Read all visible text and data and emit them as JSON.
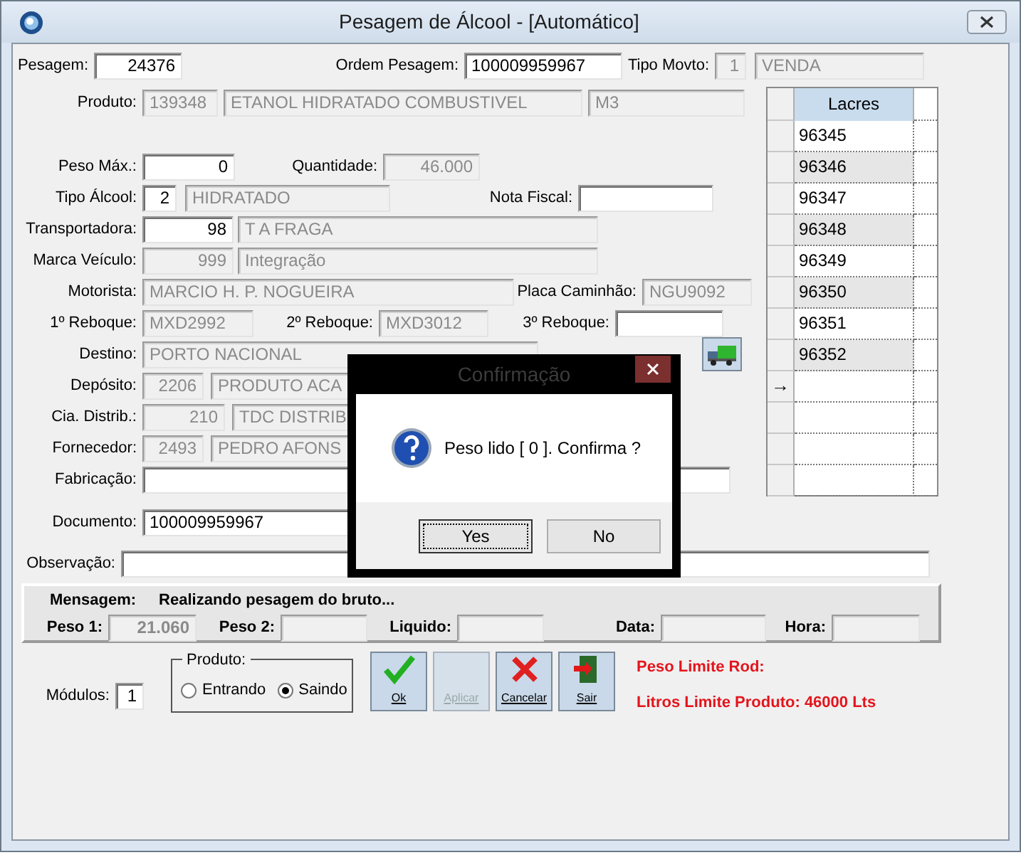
{
  "window": {
    "title": "Pesagem de Álcool - [Automático]"
  },
  "fields": {
    "pesagem": {
      "label": "Pesagem:",
      "parts": [
        {
          "text": "24376",
          "disabled": false
        }
      ]
    },
    "ordem_pesagem": {
      "label": "Ordem Pesagem:",
      "parts": [
        {
          "text": "100009959967",
          "disabled": false
        }
      ]
    },
    "tipo_movto": {
      "label": "Tipo Movto:",
      "parts": [
        {
          "text": "1",
          "disabled": true
        },
        {
          "text": "VENDA",
          "disabled": true
        }
      ]
    },
    "produto": {
      "label": "Produto:",
      "parts": [
        {
          "text": "139348",
          "disabled": true
        },
        {
          "text": "ETANOL HIDRATADO COMBUSTIVEL",
          "disabled": true
        },
        {
          "text": "M3",
          "disabled": true
        }
      ]
    },
    "peso_max": {
      "label": "Peso Máx.:",
      "parts": [
        {
          "text": "0",
          "disabled": false
        }
      ]
    },
    "quantidade": {
      "label": "Quantidade:",
      "parts": [
        {
          "text": "46.000",
          "disabled": true
        }
      ]
    },
    "tipo_alcool": {
      "label": "Tipo Álcool:",
      "parts": [
        {
          "text": "2",
          "disabled": false
        },
        {
          "text": "HIDRATADO",
          "disabled": true
        }
      ]
    },
    "nota_fiscal": {
      "label": "Nota Fiscal:",
      "parts": [
        {
          "disabled": false
        }
      ]
    },
    "transportadora": {
      "label": "Transportadora:",
      "parts": [
        {
          "text": "98",
          "disabled": false
        },
        {
          "text": "T A FRAGA",
          "disabled": true
        }
      ]
    },
    "marca_veiculo": {
      "label": "Marca Veículo:",
      "parts": [
        {
          "text": "999",
          "disabled": true
        },
        {
          "text": "Integração",
          "disabled": true
        }
      ]
    },
    "motorista": {
      "label": "Motorista:",
      "parts": [
        {
          "text": "MARCIO H. P. NOGUEIRA",
          "disabled": true
        }
      ]
    },
    "placa_caminhao": {
      "label": "Placa Caminhão:",
      "parts": [
        {
          "text": "NGU9092",
          "disabled": true
        }
      ]
    },
    "reboque_1": {
      "label": "1º Reboque:",
      "parts": [
        {
          "text": "MXD2992",
          "disabled": true
        }
      ]
    },
    "reboque_2": {
      "label": "2º Reboque:",
      "parts": [
        {
          "text": "MXD3012",
          "disabled": true
        }
      ]
    },
    "reboque_3": {
      "label": "3º Reboque:",
      "parts": [
        {
          "disabled": false
        }
      ]
    },
    "destino": {
      "label": "Destino:",
      "parts": [
        {
          "text": "PORTO NACIONAL",
          "disabled": true
        }
      ]
    },
    "deposito": {
      "label": "Depósito:",
      "parts": [
        {
          "text": "2206",
          "disabled": true
        },
        {
          "text": "PRODUTO ACA",
          "disabled": true
        }
      ]
    },
    "cia_distrib": {
      "label": "Cia. Distrib.:",
      "parts": [
        {
          "text": "210",
          "disabled": true
        },
        {
          "text": "TDC DISTRIB",
          "disabled": true
        }
      ]
    },
    "fornecedor": {
      "label": "Fornecedor:",
      "parts": [
        {
          "text": "2493",
          "disabled": true
        },
        {
          "text": "PEDRO AFONS",
          "disabled": true
        }
      ]
    },
    "fabricacao": {
      "label": "Fabricação:",
      "parts": [
        {
          "disabled": false
        }
      ]
    },
    "documento": {
      "label": "Documento:",
      "parts": [
        {
          "text": "100009959967",
          "disabled": false
        }
      ]
    },
    "observacao": {
      "label": "Observação:",
      "parts": [
        {
          "disabled": false
        }
      ]
    },
    "peso_1": {
      "label": "Peso 1:",
      "parts": [
        {
          "text": "21.060",
          "disabled": true
        }
      ]
    },
    "peso_2": {
      "label": "Peso 2:",
      "parts": [
        {
          "disabled": true
        }
      ]
    },
    "liquido": {
      "label": "Liquido:",
      "parts": [
        {
          "disabled": true
        }
      ]
    },
    "data": {
      "label": "Data:",
      "parts": [
        {
          "disabled": true
        }
      ]
    },
    "hora": {
      "label": "Hora:",
      "parts": [
        {
          "disabled": true
        }
      ]
    },
    "modulos": {
      "label": "Módulos:",
      "parts": [
        {
          "text": "1",
          "disabled": false
        }
      ]
    }
  },
  "lacres": {
    "header": "Lacres",
    "rows": [
      "96345",
      "96346",
      "96347",
      "96348",
      "96349",
      "96350",
      "96351",
      "96352"
    ],
    "new_row_marker": "→"
  },
  "message": {
    "label": "Mensagem:",
    "text": "Realizando pesagem do bruto..."
  },
  "produto_group": {
    "title": "Produto:",
    "options": [
      {
        "label": "Entrando",
        "selected": false
      },
      {
        "label": "Saindo",
        "selected": true
      }
    ]
  },
  "toolbar": [
    {
      "label": "Ok",
      "kind": "ok",
      "disabled": false
    },
    {
      "label": "Aplicar",
      "kind": "apply",
      "disabled": true
    },
    {
      "label": "Cancelar",
      "kind": "cancel",
      "disabled": false
    },
    {
      "label": "Sair",
      "kind": "exit",
      "disabled": false
    }
  ],
  "limits": [
    "Peso Limite Rod:",
    "Litros Limite Produto: 46000 Lts"
  ],
  "dialog": {
    "title": "Confirmação",
    "message": "Peso lido [ 0 ]. Confirma ?",
    "buttons": [
      {
        "label": "Yes",
        "focused": true
      },
      {
        "label": "No",
        "focused": false
      }
    ]
  }
}
